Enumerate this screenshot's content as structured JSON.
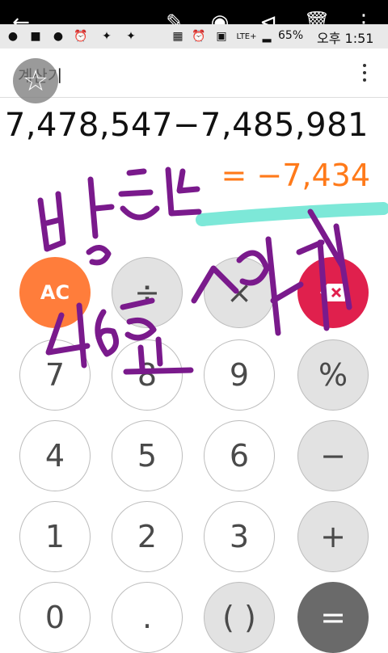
{
  "app": {
    "title": "계산기"
  },
  "status": {
    "battery": "65%",
    "clock": "오후 1:51",
    "network": "LTE+"
  },
  "toolbar": {
    "icons": [
      "back-arrow-icon",
      "pen-icon",
      "camera-icon",
      "share-icon",
      "delete-icon",
      "more-icon"
    ]
  },
  "display": {
    "expression": "7,478,547−7,485,981",
    "result": "= −7,434"
  },
  "keys": {
    "ac": "AC",
    "divide": "÷",
    "multiply": "×",
    "backspace": "⌫",
    "k7": "7",
    "k8": "8",
    "k9": "9",
    "percent": "%",
    "k4": "4",
    "k5": "5",
    "k6": "6",
    "minus": "−",
    "k1": "1",
    "k2": "2",
    "k3": "3",
    "plus": "+",
    "k0": "0",
    "dot": ".",
    "parens": "( )",
    "equals": "="
  },
  "colors": {
    "result": "#ff7a1a",
    "ac": "#ff7d3b",
    "backspace": "#e0204d",
    "equals": "#6a6a6a",
    "scribble": "#7a1a8c",
    "highlight": "#7de8d8"
  }
}
